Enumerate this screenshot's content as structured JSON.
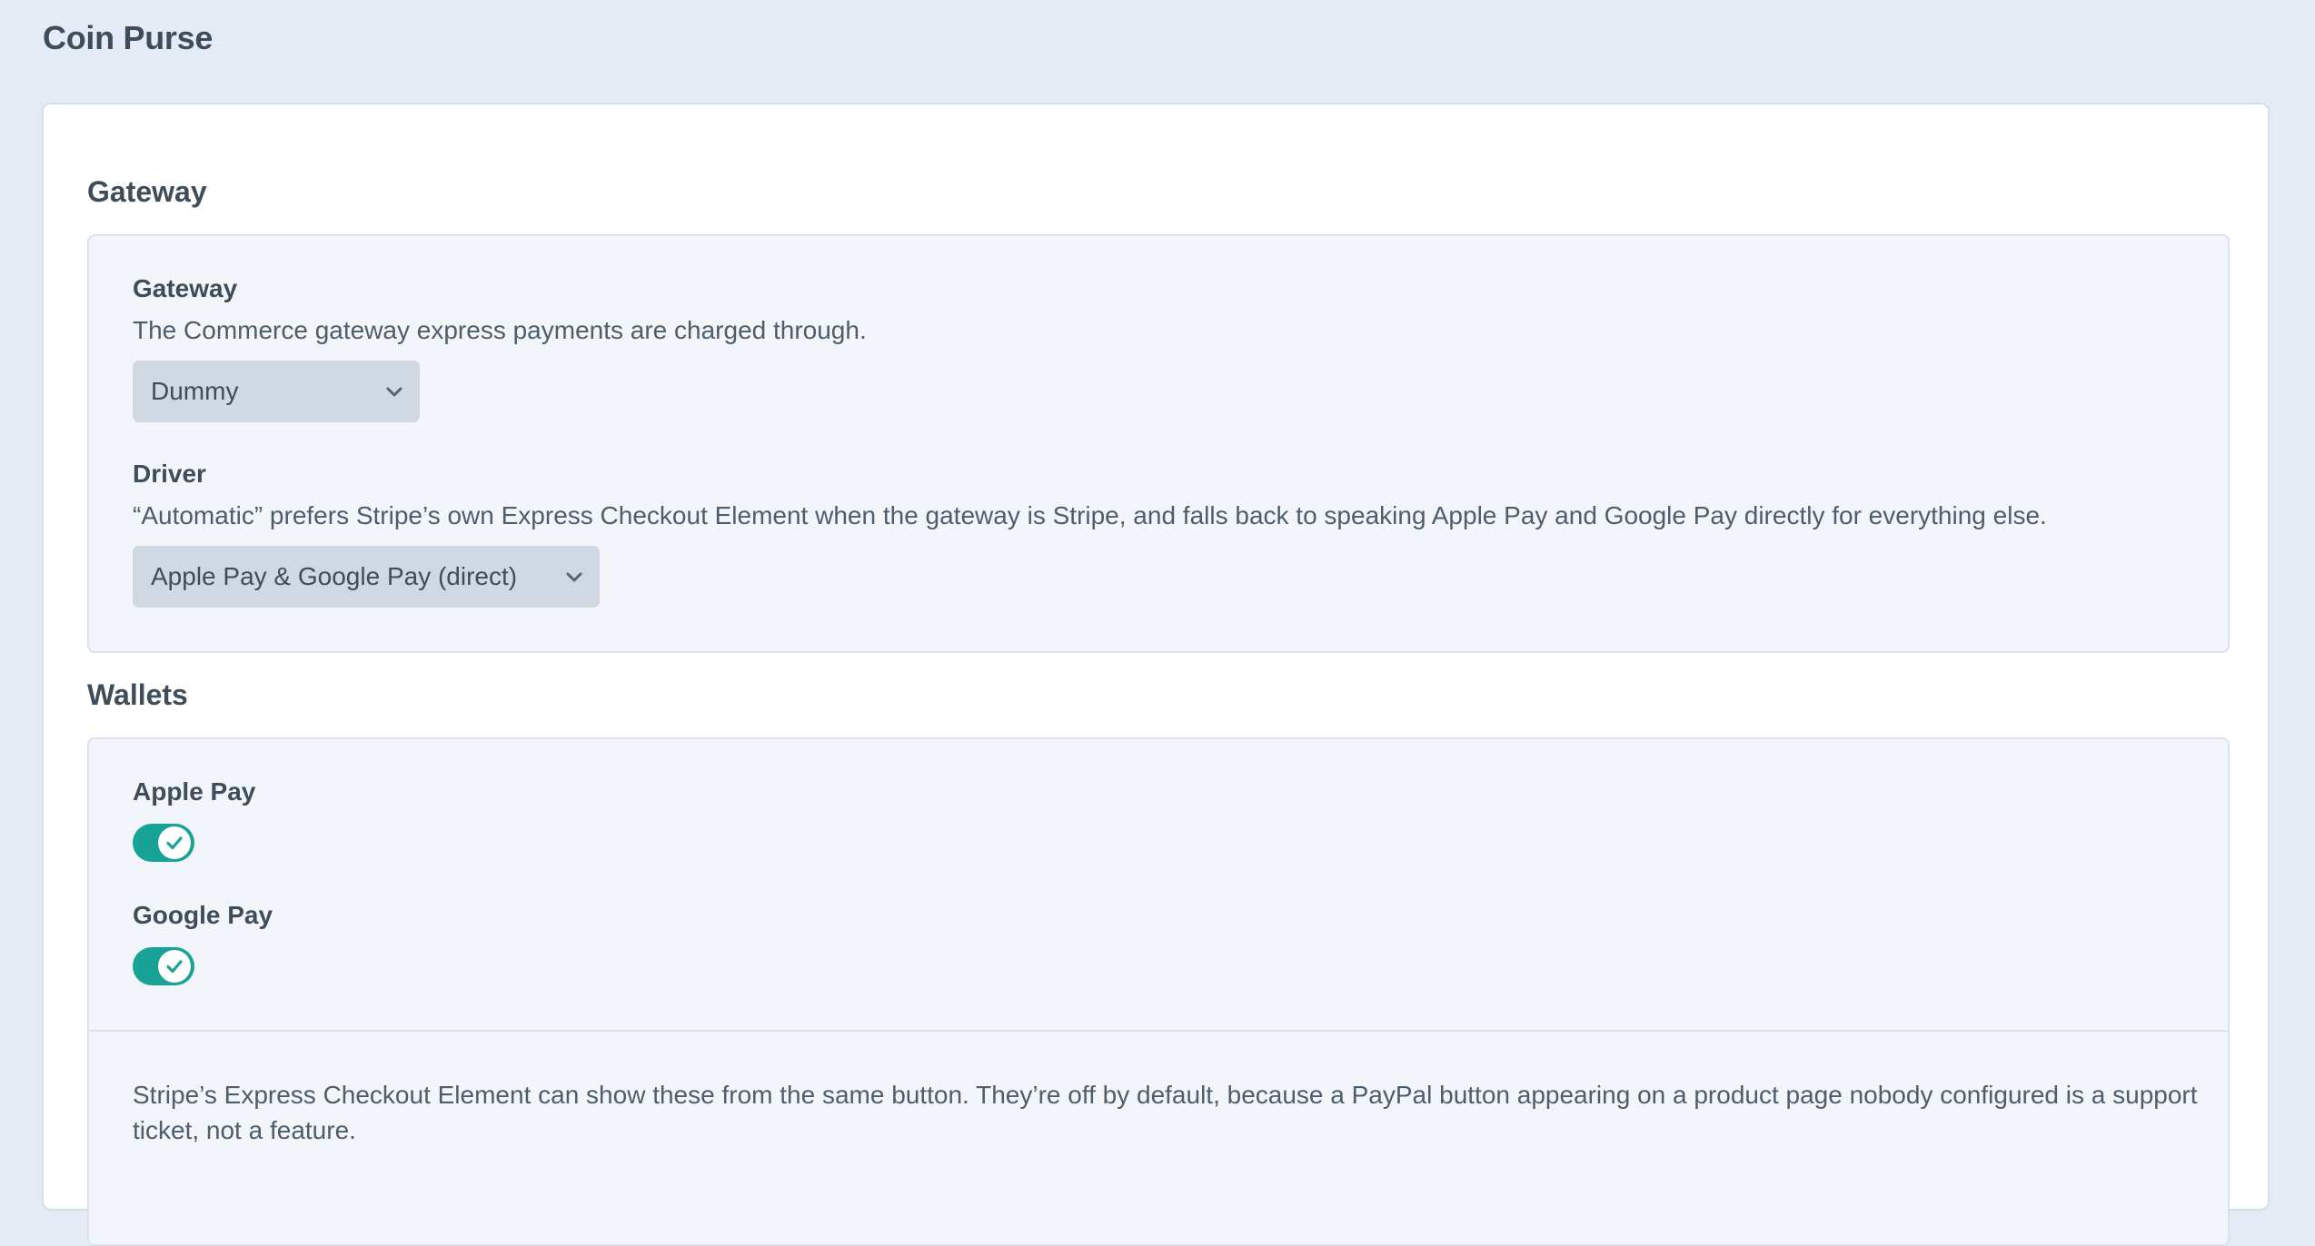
{
  "page": {
    "title": "Coin Purse"
  },
  "gateway_section": {
    "heading": "Gateway",
    "gateway_field": {
      "label": "Gateway",
      "help": "The Commerce gateway express payments are charged through.",
      "selected": "Dummy"
    },
    "driver_field": {
      "label": "Driver",
      "help": "“Automatic” prefers Stripe’s own Express Checkout Element when the gateway is Stripe, and falls back to speaking Apple Pay and Google Pay directly for everything else.",
      "selected": "Apple Pay & Google Pay (direct)"
    }
  },
  "wallets_section": {
    "heading": "Wallets",
    "apple_pay": {
      "label": "Apple Pay",
      "enabled": true
    },
    "google_pay": {
      "label": "Google Pay",
      "enabled": true
    },
    "note": "Stripe’s Express Checkout Element can show these from the same button. They’re off by default, because a PayPal button appearing on a product page nobody configured is a support ticket, not a feature."
  },
  "icons": {
    "select_chevron": "chevron-down-icon",
    "toggle_check": "check-icon"
  },
  "colors": {
    "page_background": "#e4ebf4",
    "card_background": "#ffffff",
    "panel_background": "#f2f5fa",
    "select_background": "#cfd8e3",
    "toggle_on": "#18a396",
    "text": "#3f4d5a"
  }
}
